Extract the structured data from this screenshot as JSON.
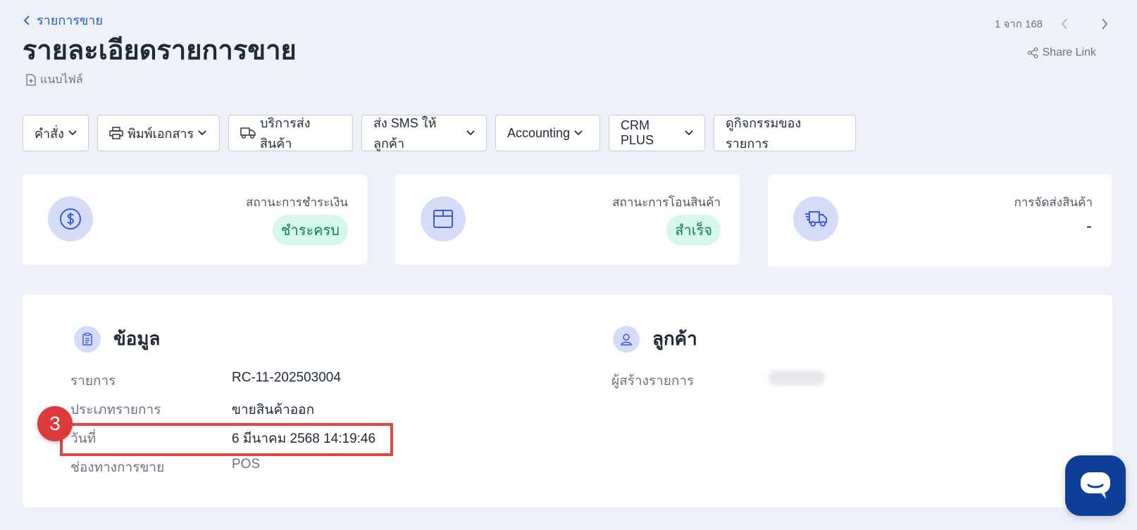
{
  "header": {
    "back_label": "รายการขาย",
    "title": "รายละเอียดรายการขาย",
    "attach_label": "แนบไฟล์",
    "pager_text": "1 จาก 168",
    "share_label": "Share Link"
  },
  "toolbar": {
    "command": "คำสั่ง",
    "print": "พิมพ์เอกสาร",
    "shipping_service": "บริการส่งสินค้า",
    "sms": "ส่ง SMS ให้ลูกค้า",
    "accounting": "Accounting",
    "crm": "CRM PLUS",
    "activity": "ดูกิจกรรมของรายการ"
  },
  "status": {
    "payment_label": "สถานะการชำระเงิน",
    "payment_value": "ชำระครบ",
    "transfer_label": "สถานะการโอนสินค้า",
    "transfer_value": "สำเร็จ",
    "delivery_label": "การจัดส่งสินค้า",
    "delivery_value": "-"
  },
  "info": {
    "title": "ข้อมูล",
    "rows": [
      {
        "key": "รายการ",
        "value": "RC-11-202503004"
      },
      {
        "key": "ประเภทรายการ",
        "value": "ขายสินค้าออก"
      },
      {
        "key": "วันที่",
        "value": "6 มีนาคม 2568 14:19:46"
      },
      {
        "key": "ช่องทางการขาย",
        "value": "POS"
      }
    ]
  },
  "customer": {
    "title": "ลูกค้า",
    "creator_label": "ผู้สร้างรายการ"
  },
  "annotation": {
    "step": "3",
    "highlight_color": "#e04848"
  },
  "colors": {
    "accent": "#1d5fbf",
    "badge_bg": "#d6f7ec",
    "badge_text": "#0f7a55",
    "chat_button": "#0d3f99"
  }
}
